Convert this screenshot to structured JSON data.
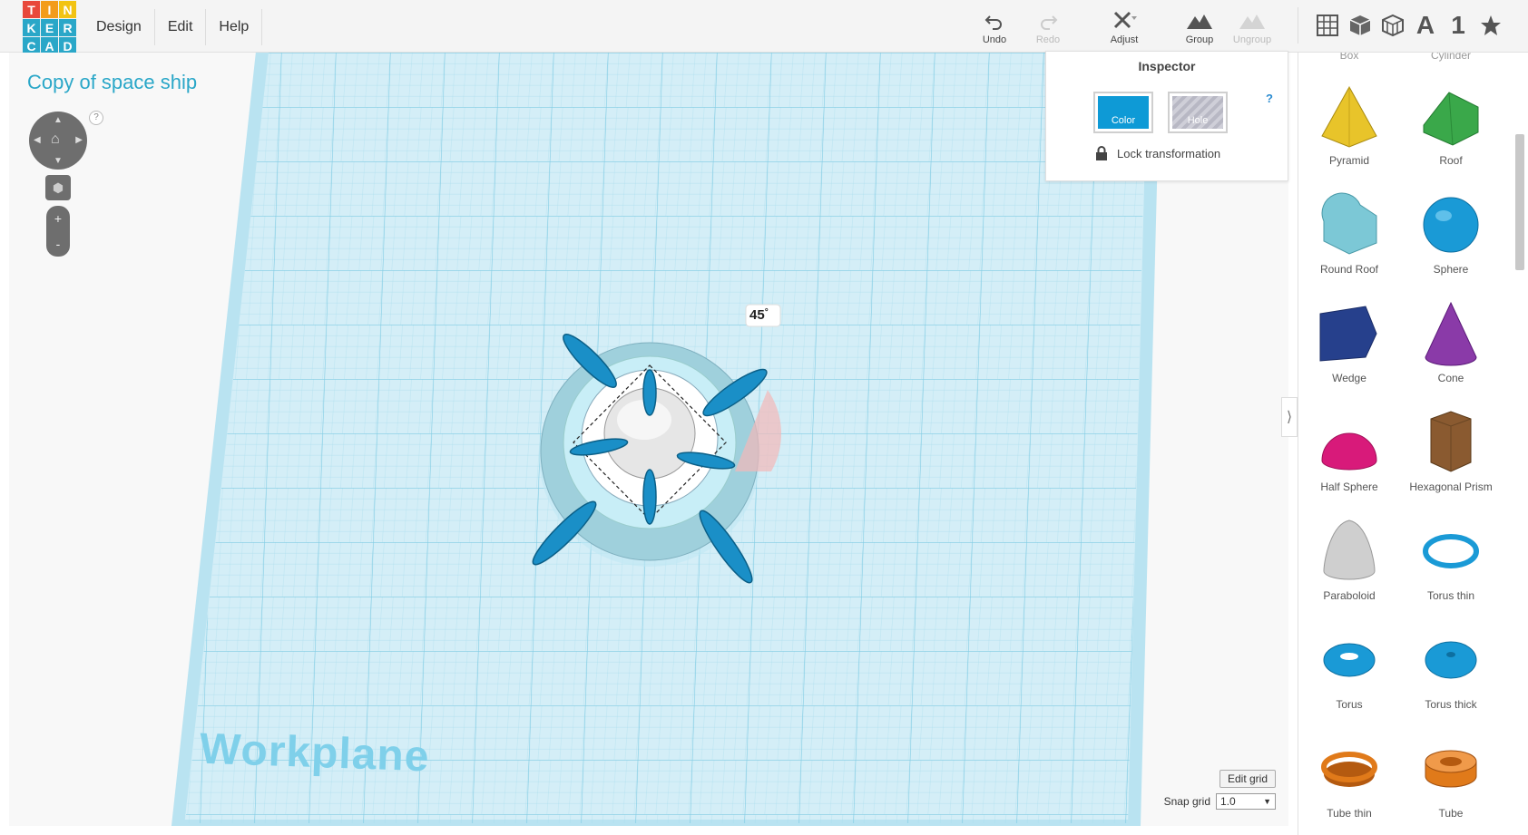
{
  "logo": {
    "letters": [
      "T",
      "I",
      "N",
      "K",
      "E",
      "R",
      "C",
      "A",
      "D"
    ],
    "colors": [
      "#e8483b",
      "#f39c1b",
      "#f2c313",
      "#2aa7c8",
      "#2aa7c8",
      "#2aa7c8",
      "#2aa7c8",
      "#2aa7c8",
      "#2aa7c8"
    ]
  },
  "menu": [
    {
      "name": "menu-design",
      "label": "Design"
    },
    {
      "name": "menu-edit",
      "label": "Edit"
    },
    {
      "name": "menu-help",
      "label": "Help"
    }
  ],
  "toolbar": {
    "undo": "Undo",
    "redo": "Redo",
    "adjust": "Adjust",
    "group": "Group",
    "ungroup": "Ungroup"
  },
  "view_icons": {
    "text_tool": "A",
    "number_tool": "1"
  },
  "project": {
    "title": "Copy of space ship"
  },
  "nav": {
    "zoom_in": "+",
    "zoom_out": "-",
    "help": "?"
  },
  "canvas": {
    "workplane_label": "Workplane",
    "rotation_readout": "45",
    "rotation_unit": "°"
  },
  "inspector": {
    "title": "Inspector",
    "help": "?",
    "color_label": "Color",
    "hole_label": "Hole",
    "lock_label": "Lock transformation",
    "color_hex": "#0e9ad6"
  },
  "grid": {
    "edit_label": "Edit grid",
    "snap_label": "Snap grid",
    "snap_value": "1.0",
    "caret": "▼"
  },
  "collapse": {
    "glyph": "⟩"
  },
  "shapes_panel": {
    "partial_top": [
      "Box",
      "Cylinder"
    ],
    "items": [
      {
        "label": "Pyramid",
        "icon": "pyramid-icon",
        "color": "#e8c42a"
      },
      {
        "label": "Roof",
        "icon": "roof-icon",
        "color": "#3aa84a"
      },
      {
        "label": "Round Roof",
        "icon": "round-roof-icon",
        "color": "#7cc8d6"
      },
      {
        "label": "Sphere",
        "icon": "sphere-icon",
        "color": "#1a9ad6"
      },
      {
        "label": "Wedge",
        "icon": "wedge-icon",
        "color": "#26408c"
      },
      {
        "label": "Cone",
        "icon": "cone-icon",
        "color": "#8a3aa8"
      },
      {
        "label": "Half Sphere",
        "icon": "half-sphere-icon",
        "color": "#d81a7a"
      },
      {
        "label": "Hexagonal Prism",
        "icon": "hex-prism-icon",
        "color": "#8a5a30"
      },
      {
        "label": "Paraboloid",
        "icon": "paraboloid-icon",
        "color": "#cfcfcf"
      },
      {
        "label": "Torus thin",
        "icon": "torus-thin-icon",
        "color": "#1a9ad6"
      },
      {
        "label": "Torus",
        "icon": "torus-icon",
        "color": "#1a9ad6"
      },
      {
        "label": "Torus thick",
        "icon": "torus-thick-icon",
        "color": "#1a9ad6"
      },
      {
        "label": "Tube thin",
        "icon": "tube-thin-icon",
        "color": "#e07a1a"
      },
      {
        "label": "Tube",
        "icon": "tube-icon",
        "color": "#e07a1a"
      }
    ]
  }
}
